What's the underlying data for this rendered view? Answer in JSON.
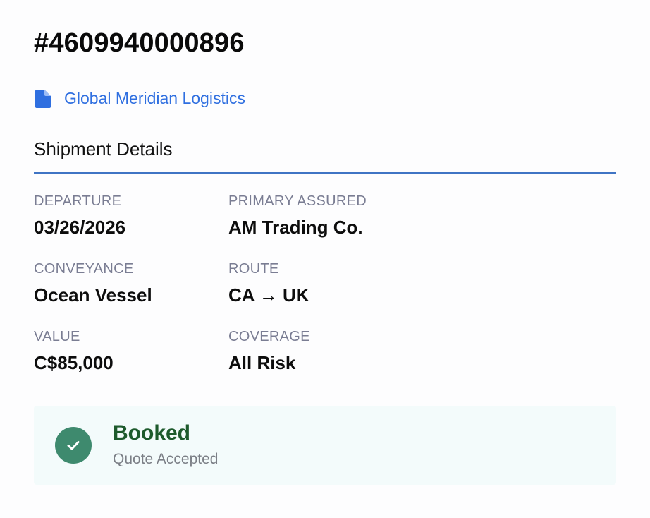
{
  "shipment": {
    "id": "#4609940000896",
    "company": "Global Meridian Logistics"
  },
  "section": {
    "title": "Shipment Details"
  },
  "details": {
    "departure_label": "DEPARTURE",
    "departure_value": "03/26/2026",
    "primary_assured_label": "PRIMARY ASSURED",
    "primary_assured_value": "AM Trading Co.",
    "conveyance_label": "CONVEYANCE",
    "conveyance_value": "Ocean Vessel",
    "route_label": "ROUTE",
    "route_value": "CA → UK",
    "value_label": "VALUE",
    "value_value": "C$85,000",
    "coverage_label": "COVERAGE",
    "coverage_value": "All Risk"
  },
  "status": {
    "title": "Booked",
    "subtitle": "Quote Accepted",
    "icon": "check-icon",
    "color": "#3e8a6e"
  },
  "colors": {
    "link": "#2f6fe0",
    "rule": "#3f74c4",
    "status_text": "#1d5a2c",
    "card_bg": "#f3fbfb"
  }
}
